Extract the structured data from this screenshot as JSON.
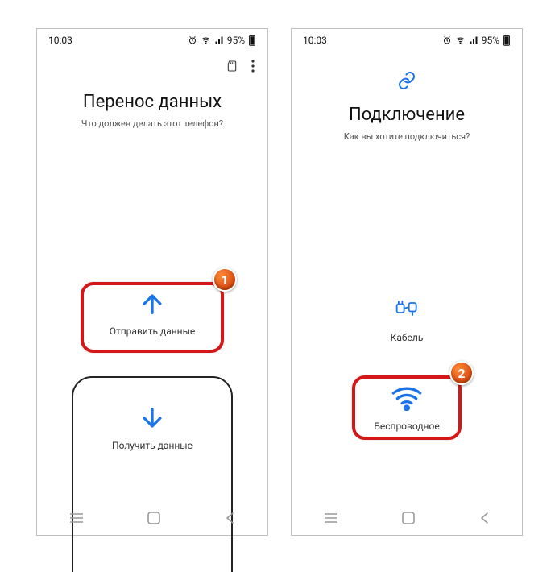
{
  "status": {
    "time": "10:03",
    "battery": "95%"
  },
  "screen1": {
    "title": "Перенос данных",
    "subtitle": "Что должен делать этот телефон?",
    "send_label": "Отправить данные",
    "receive_label": "Получить данные"
  },
  "screen2": {
    "title": "Подключение",
    "subtitle": "Как вы хотите подключиться?",
    "cable_label": "Кабель",
    "wireless_label": "Беспроводное"
  },
  "annotations": {
    "badge1": "1",
    "badge2": "2"
  }
}
